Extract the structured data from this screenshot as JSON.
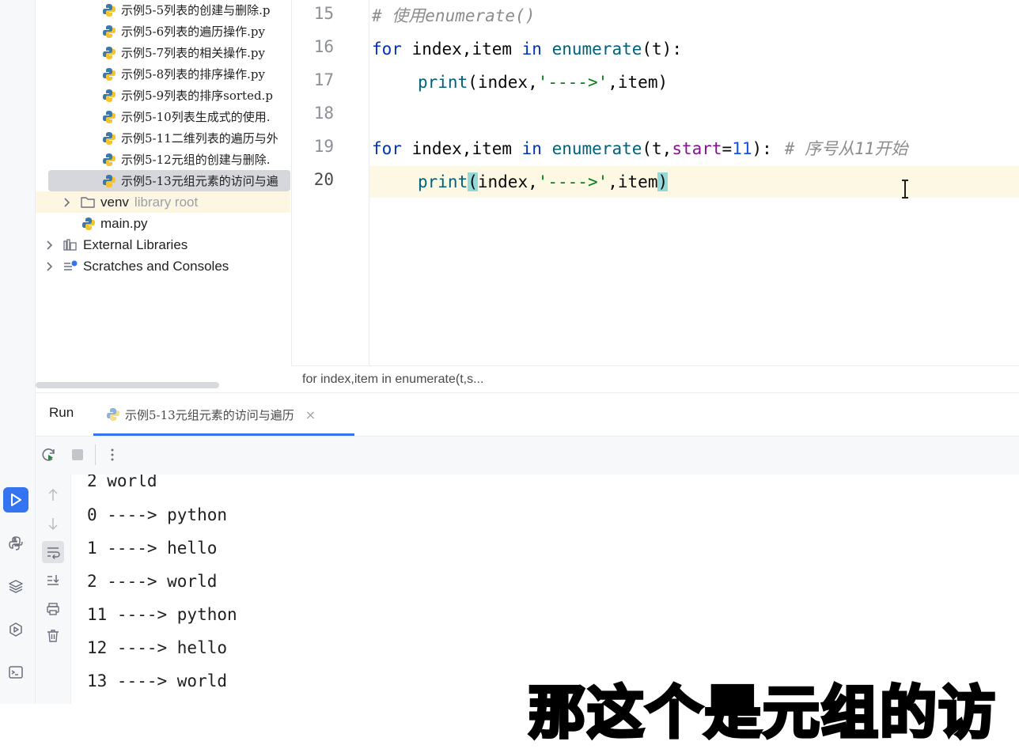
{
  "project_tree": {
    "items": [
      {
        "label": "示例5-5列表的创建与删除.p",
        "type": "python-file"
      },
      {
        "label": "示例5-6列表的遍历操作.py",
        "type": "python-file"
      },
      {
        "label": "示例5-7列表的相关操作.py",
        "type": "python-file"
      },
      {
        "label": "示例5-8列表的排序操作.py",
        "type": "python-file"
      },
      {
        "label": "示例5-9列表的排序sorted.p",
        "type": "python-file"
      },
      {
        "label": "示例5-10列表生成式的使用.",
        "type": "python-file"
      },
      {
        "label": "示例5-11二维列表的遍历与外",
        "type": "python-file"
      },
      {
        "label": "示例5-12元组的创建与删除.",
        "type": "python-file"
      },
      {
        "label": "示例5-13元组元素的访问与遍",
        "type": "python-file",
        "selected": true
      }
    ],
    "venv": {
      "label": "venv",
      "hint": "library root"
    },
    "main_file": "main.py",
    "external_libraries": "External Libraries",
    "scratches": "Scratches and Consoles"
  },
  "editor": {
    "lines": [
      {
        "no": "15"
      },
      {
        "no": "16"
      },
      {
        "no": "17"
      },
      {
        "no": "18"
      },
      {
        "no": "19"
      },
      {
        "no": "20",
        "current": true
      }
    ],
    "code": {
      "l15_comment": "# 使用enumerate()",
      "l16_for": "for",
      "l16_vars": " index,item ",
      "l16_in": "in",
      "l16_fn": " enumerate",
      "l16_rest": "(t):",
      "l17_fn": "print",
      "l17_open": "(index,",
      "l17_str": "'---->'",
      "l17_rest": ",item)",
      "l19_for": "for",
      "l19_vars": " index,item ",
      "l19_in": "in",
      "l19_fn": " enumerate",
      "l19_open": "(t,",
      "l19_param": "start",
      "l19_eq": "=",
      "l19_num": "11",
      "l19_close": "):",
      "l19_comment": "# 序号从11开始",
      "l20_fn": "print",
      "l20_lp": "(",
      "l20_args": "index,",
      "l20_str": "'---->'",
      "l20_rest": ",item",
      "l20_rp": ")"
    },
    "breadcrumb": "for index,item in enumerate(t,s..."
  },
  "run_panel": {
    "title": "Run",
    "tab_label": "示例5-13元组元素的访问与遍历",
    "tab_close": "×",
    "output": [
      "2 world",
      "0 ----> python",
      "1 ----> hello",
      "2 ----> world",
      "11 ----> python",
      "12 ----> hello",
      "13 ----> world"
    ]
  },
  "overlay": {
    "subtitle": "那这个是元组的访"
  },
  "colors": {
    "keyword": "#0033b3",
    "function": "#00627a",
    "string": "#067d17",
    "number": "#1750eb",
    "param": "#871094",
    "accent": "#3574f0"
  }
}
